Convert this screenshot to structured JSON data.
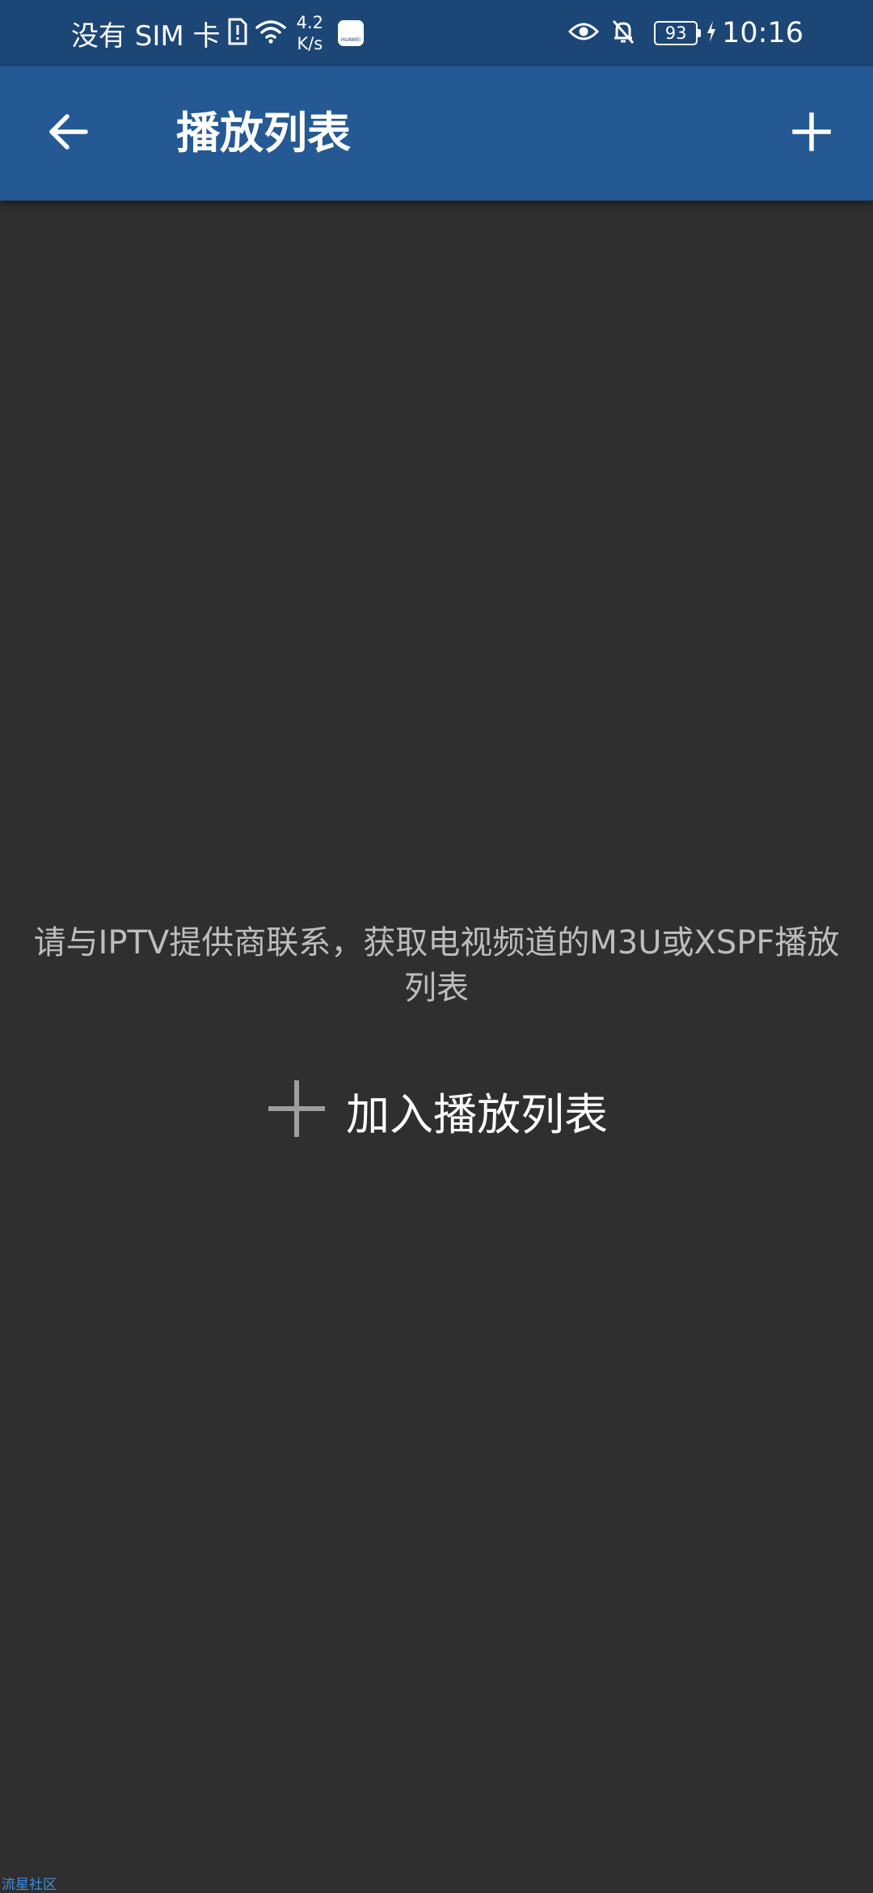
{
  "status_bar": {
    "carrier": "没有 SIM 卡",
    "net_speed_value": "4.2",
    "net_speed_unit": "K/s",
    "huawei_badge": "HUAWEI",
    "battery": "93",
    "time": "10:16",
    "icons": [
      "sim-alert-icon",
      "wifi-icon",
      "huawei-appgallery-icon",
      "eye-icon",
      "bell-off-icon",
      "battery-icon",
      "charging-icon"
    ]
  },
  "app_bar": {
    "title": "播放列表",
    "back_icon": "arrow-left-icon",
    "add_icon": "plus-icon"
  },
  "main": {
    "empty_message": "请与IPTV提供商联系，获取电视频道的M3U或XSPF播放列表",
    "add_playlist_label": "加入播放列表",
    "add_playlist_icon": "plus-icon"
  },
  "watermark": "流星社区",
  "colors": {
    "status_bar_bg": "#1c4676",
    "app_bar_bg": "#245994",
    "background": "#2f2f2f",
    "message_text": "#bdbdbd",
    "watermark": "#3f8fe0"
  }
}
